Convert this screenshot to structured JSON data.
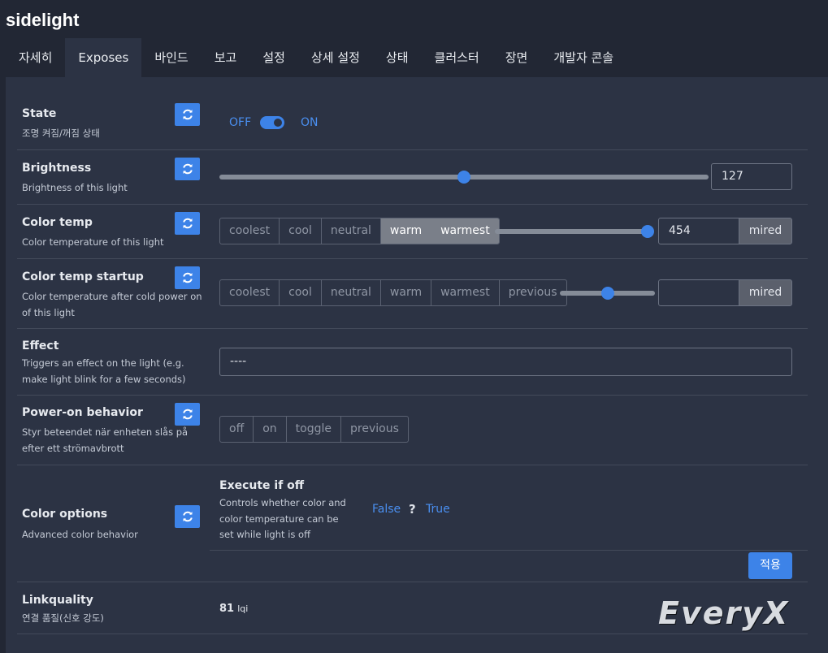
{
  "app_title": "sidelight",
  "tabs": [
    "자세히",
    "Exposes",
    "바인드",
    "보고",
    "설정",
    "상세 설정",
    "상태",
    "클러스터",
    "장면",
    "개발자 콘솔"
  ],
  "state": {
    "label": "State",
    "desc": "조명 켜짐/꺼짐 상태",
    "off": "OFF",
    "on": "ON",
    "value": "ON"
  },
  "brightness": {
    "label": "Brightness",
    "desc": "Brightness of this light",
    "value": "127",
    "level_fraction": 0.5
  },
  "color_temp": {
    "label": "Color temp",
    "desc": "Color temperature of this light",
    "presets": [
      "coolest",
      "cool",
      "neutral",
      "warm",
      "warmest"
    ],
    "selected": [
      "warm",
      "warmest"
    ],
    "value": "454",
    "unit": "mired",
    "level_fraction": 0.98
  },
  "color_temp_startup": {
    "label": "Color temp startup",
    "desc": "Color temperature after cold power on of this light",
    "presets": [
      "coolest",
      "cool",
      "neutral",
      "warm",
      "warmest",
      "previous"
    ],
    "value": "",
    "unit": "mired",
    "level_fraction": 0.5
  },
  "effect": {
    "label": "Effect",
    "desc": "Triggers an effect on the light (e.g. make light blink for a few seconds)",
    "value": "----"
  },
  "power_on": {
    "label": "Power-on behavior",
    "desc": "Styr beteendet när enheten slås på efter ett strömavbrott",
    "options": [
      "off",
      "on",
      "toggle",
      "previous"
    ]
  },
  "color_options": {
    "label": "Color options",
    "desc": "Advanced color behavior",
    "execute_label": "Execute if off",
    "execute_desc": "Controls whether color and color temperature can be set while light is off",
    "false_label": "False",
    "unknown": "?",
    "true_label": "True",
    "apply": "적용"
  },
  "linkquality": {
    "label": "Linkquality",
    "desc": "연결 품질(신호 강도)",
    "value": "81",
    "unit": "lqi"
  },
  "watermark": "EveryX"
}
